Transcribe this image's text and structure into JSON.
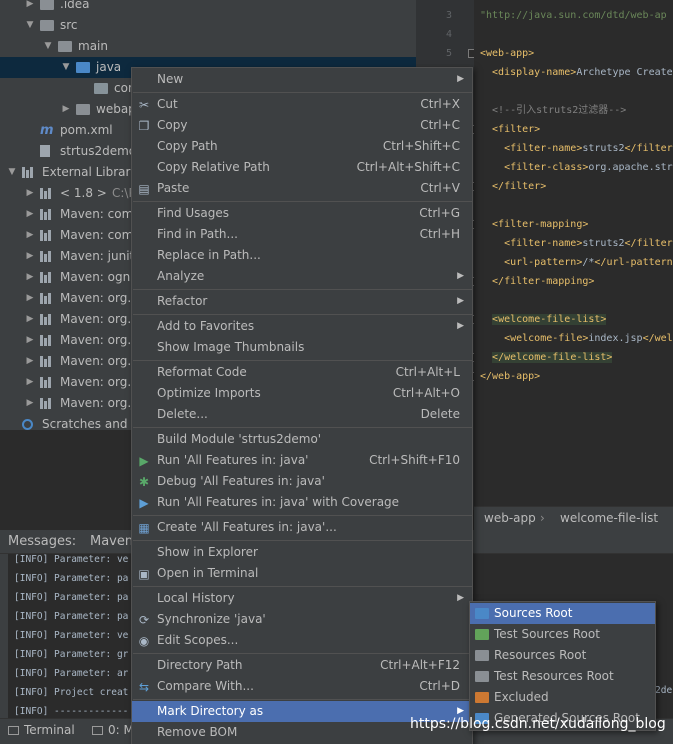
{
  "project_tree": [
    {
      "label": ".idea",
      "indent": 1,
      "arrow": "right",
      "icon": "folder-gray"
    },
    {
      "label": "src",
      "indent": 1,
      "arrow": "down",
      "icon": "folder-gray"
    },
    {
      "label": "main",
      "indent": 2,
      "arrow": "down",
      "icon": "folder-gray"
    },
    {
      "label": "java",
      "indent": 3,
      "arrow": "down",
      "icon": "folder-blue",
      "selected": true
    },
    {
      "label": "con",
      "indent": 4,
      "arrow": "",
      "icon": "folder-pkg"
    },
    {
      "label": "webap",
      "indent": 3,
      "arrow": "right",
      "icon": "folder-gray"
    },
    {
      "label": "pom.xml",
      "indent": 1,
      "arrow": "",
      "icon": "maven-m"
    },
    {
      "label": "strtus2demo",
      "indent": 1,
      "arrow": "",
      "icon": "file"
    },
    {
      "label": "External Librarie",
      "indent": 0,
      "arrow": "down",
      "icon": "library"
    },
    {
      "label": "< 1.8 >",
      "dim": "C:\\P",
      "indent": 1,
      "arrow": "right",
      "icon": "jdk"
    },
    {
      "label": "Maven: com",
      "indent": 1,
      "arrow": "right",
      "icon": "library"
    },
    {
      "label": "Maven: com",
      "indent": 1,
      "arrow": "right",
      "icon": "library"
    },
    {
      "label": "Maven: junit",
      "indent": 1,
      "arrow": "right",
      "icon": "library"
    },
    {
      "label": "Maven: ognl",
      "indent": 1,
      "arrow": "right",
      "icon": "library"
    },
    {
      "label": "Maven: org.a",
      "indent": 1,
      "arrow": "right",
      "icon": "library"
    },
    {
      "label": "Maven: org.a",
      "indent": 1,
      "arrow": "right",
      "icon": "library"
    },
    {
      "label": "Maven: org.a",
      "indent": 1,
      "arrow": "right",
      "icon": "library"
    },
    {
      "label": "Maven: org.f",
      "indent": 1,
      "arrow": "right",
      "icon": "library"
    },
    {
      "label": "Maven: org.h",
      "indent": 1,
      "arrow": "right",
      "icon": "library"
    },
    {
      "label": "Maven: org.j",
      "indent": 1,
      "arrow": "right",
      "icon": "library"
    },
    {
      "label": "Scratches and C",
      "indent": 0,
      "arrow": "",
      "icon": "scratches"
    }
  ],
  "gutter_lines": [
    "3",
    "4",
    "5"
  ],
  "editor": {
    "lines": [
      {
        "kind": "str",
        "text": "\"http://java.sun.com/dtd/web-ap"
      },
      {
        "kind": "blank",
        "text": ""
      },
      {
        "kind": "tag",
        "text": "<web-app>"
      },
      {
        "kind": "mixed",
        "text": "  <display-name>Archetype Create"
      },
      {
        "kind": "blank",
        "text": ""
      },
      {
        "kind": "comment",
        "text": "  <!--引入struts2过滤器-->"
      },
      {
        "kind": "tag",
        "text": "  <filter>"
      },
      {
        "kind": "mixed",
        "text": "    <filter-name>struts2</filter"
      },
      {
        "kind": "mixed",
        "text": "    <filter-class>org.apache.str"
      },
      {
        "kind": "tag",
        "text": "  </filter>"
      },
      {
        "kind": "blank",
        "text": ""
      },
      {
        "kind": "tag",
        "text": "  <filter-mapping>"
      },
      {
        "kind": "mixed",
        "text": "    <filter-name>struts2</filter"
      },
      {
        "kind": "mixed",
        "text": "    <url-pattern>/*</url-pattern"
      },
      {
        "kind": "tag",
        "text": "  </filter-mapping>"
      },
      {
        "kind": "blank",
        "text": ""
      },
      {
        "kind": "hltag",
        "text": "  <welcome-file-list>"
      },
      {
        "kind": "mixed",
        "text": "    <welcome-file>index.jsp</wel"
      },
      {
        "kind": "hltag",
        "text": "  </welcome-file-list>"
      },
      {
        "kind": "tag",
        "text": "</web-app>"
      }
    ]
  },
  "breadcrumbs": [
    "web-app",
    "welcome-file-list"
  ],
  "messages": {
    "title": "Messages:",
    "tab2": "Maven",
    "log": [
      "[INFO] Parameter: ve",
      "[INFO] Parameter: pa",
      "[INFO] Parameter: pa",
      "[INFO] Parameter: pa",
      "[INFO] Parameter: ve",
      "[INFO] Parameter: gr",
      "[INFO] Parameter: ar",
      "[INFO] Project creat",
      "[INFO] -------------"
    ],
    "log_tail": "2de"
  },
  "statusbar": {
    "terminal": "Terminal",
    "messages_tab": "0: M"
  },
  "watermark": "https://blog.csdn.net/xudailong_blog",
  "context_menu": {
    "items": [
      {
        "label": "New",
        "submenu": true
      },
      {
        "sep": true
      },
      {
        "label": "Cut",
        "shortcut": "Ctrl+X",
        "icon": "scissors"
      },
      {
        "label": "Copy",
        "shortcut": "Ctrl+C",
        "icon": "copy"
      },
      {
        "label": "Copy Path",
        "shortcut": "Ctrl+Shift+C"
      },
      {
        "label": "Copy Relative Path",
        "shortcut": "Ctrl+Alt+Shift+C"
      },
      {
        "label": "Paste",
        "shortcut": "Ctrl+V",
        "icon": "paste"
      },
      {
        "sep": true
      },
      {
        "label": "Find Usages",
        "shortcut": "Ctrl+G"
      },
      {
        "label": "Find in Path...",
        "shortcut": "Ctrl+H"
      },
      {
        "label": "Replace in Path..."
      },
      {
        "label": "Analyze",
        "submenu": true
      },
      {
        "sep": true
      },
      {
        "label": "Refactor",
        "submenu": true
      },
      {
        "sep": true
      },
      {
        "label": "Add to Favorites",
        "submenu": true
      },
      {
        "label": "Show Image Thumbnails"
      },
      {
        "sep": true
      },
      {
        "label": "Reformat Code",
        "shortcut": "Ctrl+Alt+L"
      },
      {
        "label": "Optimize Imports",
        "shortcut": "Ctrl+Alt+O"
      },
      {
        "label": "Delete...",
        "shortcut": "Delete"
      },
      {
        "sep": true
      },
      {
        "label": "Build Module 'strtus2demo'"
      },
      {
        "label": "Run 'All Features in: java'",
        "shortcut": "Ctrl+Shift+F10",
        "icon": "run"
      },
      {
        "label": "Debug 'All Features in: java'",
        "icon": "debug"
      },
      {
        "label": "Run 'All Features in: java' with Coverage",
        "icon": "coverage"
      },
      {
        "sep": true
      },
      {
        "label": "Create 'All Features in: java'...",
        "icon": "create"
      },
      {
        "sep": true
      },
      {
        "label": "Show in Explorer"
      },
      {
        "label": "Open in Terminal",
        "icon": "terminal"
      },
      {
        "sep": true
      },
      {
        "label": "Local History",
        "submenu": true
      },
      {
        "label": "Synchronize 'java'",
        "icon": "sync"
      },
      {
        "label": "Edit Scopes...",
        "icon": "scopes"
      },
      {
        "sep": true
      },
      {
        "label": "Directory Path",
        "shortcut": "Ctrl+Alt+F12"
      },
      {
        "label": "Compare With...",
        "shortcut": "Ctrl+D",
        "icon": "compare"
      },
      {
        "sep": true
      },
      {
        "label": "Mark Directory as",
        "submenu": true,
        "active": true
      },
      {
        "label": "Remove BOM"
      }
    ]
  },
  "submenu": {
    "items": [
      {
        "label": "Sources Root",
        "color": "#4a88c7",
        "active": true
      },
      {
        "label": "Test Sources Root",
        "color": "#62a35a"
      },
      {
        "label": "Resources Root",
        "color": "#8a8f94"
      },
      {
        "label": "Test Resources Root",
        "color": "#8a8f94"
      },
      {
        "label": "Excluded",
        "color": "#cc7832"
      },
      {
        "label": "Generated Sources Root",
        "color": "#4a88c7"
      }
    ]
  },
  "colors": {
    "selection": "#4b6eaf",
    "panel": "#3c3f41",
    "editor_bg": "#2b2b2b"
  }
}
